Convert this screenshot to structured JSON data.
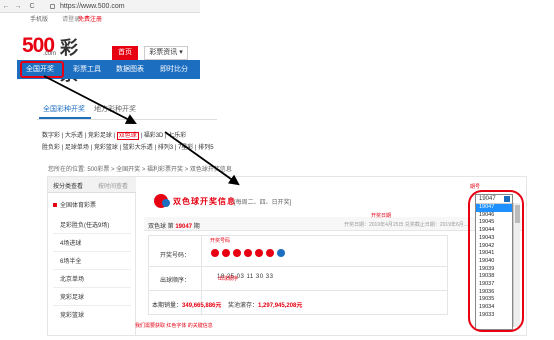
{
  "browser": {
    "url": "https://www.500.com",
    "nav": {
      "back": "←",
      "forward": "→",
      "reload": "C"
    }
  },
  "site": {
    "mobile_link": "手机版",
    "login": "请登录",
    "register": "免费注册",
    "logo": {
      "digits": "500",
      "sub": ".com",
      "cn": "彩票"
    },
    "home_button": "首页",
    "news_menu": "彩票资讯 ▾",
    "nav_items": [
      "全国开奖",
      "彩票工具",
      "数据图表",
      "即时比分"
    ]
  },
  "lottery_tabs": {
    "tab_national": "全国彩种开奖",
    "tab_local": "地方彩种开奖",
    "row1": [
      "数字彩",
      "大乐透",
      "竞彩足球",
      "双色球",
      "福彩3D",
      "七乐彩"
    ],
    "row2": [
      "胜负彩",
      "足球单场",
      "竞彩篮球",
      "篮彩大乐透",
      "排列3",
      "7星彩",
      "排列5"
    ]
  },
  "page": {
    "breadcrumb": "您所在的位置: 500彩票 > 全国开奖 > 福利彩票开奖 > 双色球开奖信息",
    "sidebar": {
      "tab_by_category": "按分类查看",
      "tab_by_time": "按时间查看",
      "heading": "全国体育彩票",
      "items": [
        "足彩胜负(任选9场)",
        "4场进球",
        "6场半全",
        "北京单场",
        "竞彩足球",
        "竞彩篮球"
      ]
    },
    "title": "双色球开奖信息",
    "title_sub": "[每周二、四、日开奖]",
    "issue_prefix": "双色球 第",
    "issue": "19047",
    "issue_suffix": "期",
    "open_date": "开奖日期：2019年4月25日 兑奖截止日期：2019年6月…",
    "row_number_label": "开奖号码：",
    "row_sequence_label": "出球顺序：",
    "sequence": "18 25 03 11 30 33",
    "sales_label": "本期销量：",
    "sales_value": "349,665,886元",
    "pool_label": "奖池滚存：",
    "pool_value": "1,297,945,208元"
  },
  "annotations": {
    "period": "期号",
    "open_date": "开奖日期",
    "red_numbers": "开奖号码",
    "order": "出球顺序",
    "note": "我们需要获取 红色字体 的关键信息"
  },
  "issue_select": {
    "selected": "19047",
    "options": [
      "19047",
      "19046",
      "19045",
      "19044",
      "19043",
      "19042",
      "19041",
      "19040",
      "19039",
      "19038",
      "19037",
      "19036",
      "19035",
      "19034",
      "19033"
    ]
  },
  "colors": {
    "accent_red": "#e60012",
    "nav_blue": "#1c6ec1",
    "highlight": "#1e90ff"
  }
}
